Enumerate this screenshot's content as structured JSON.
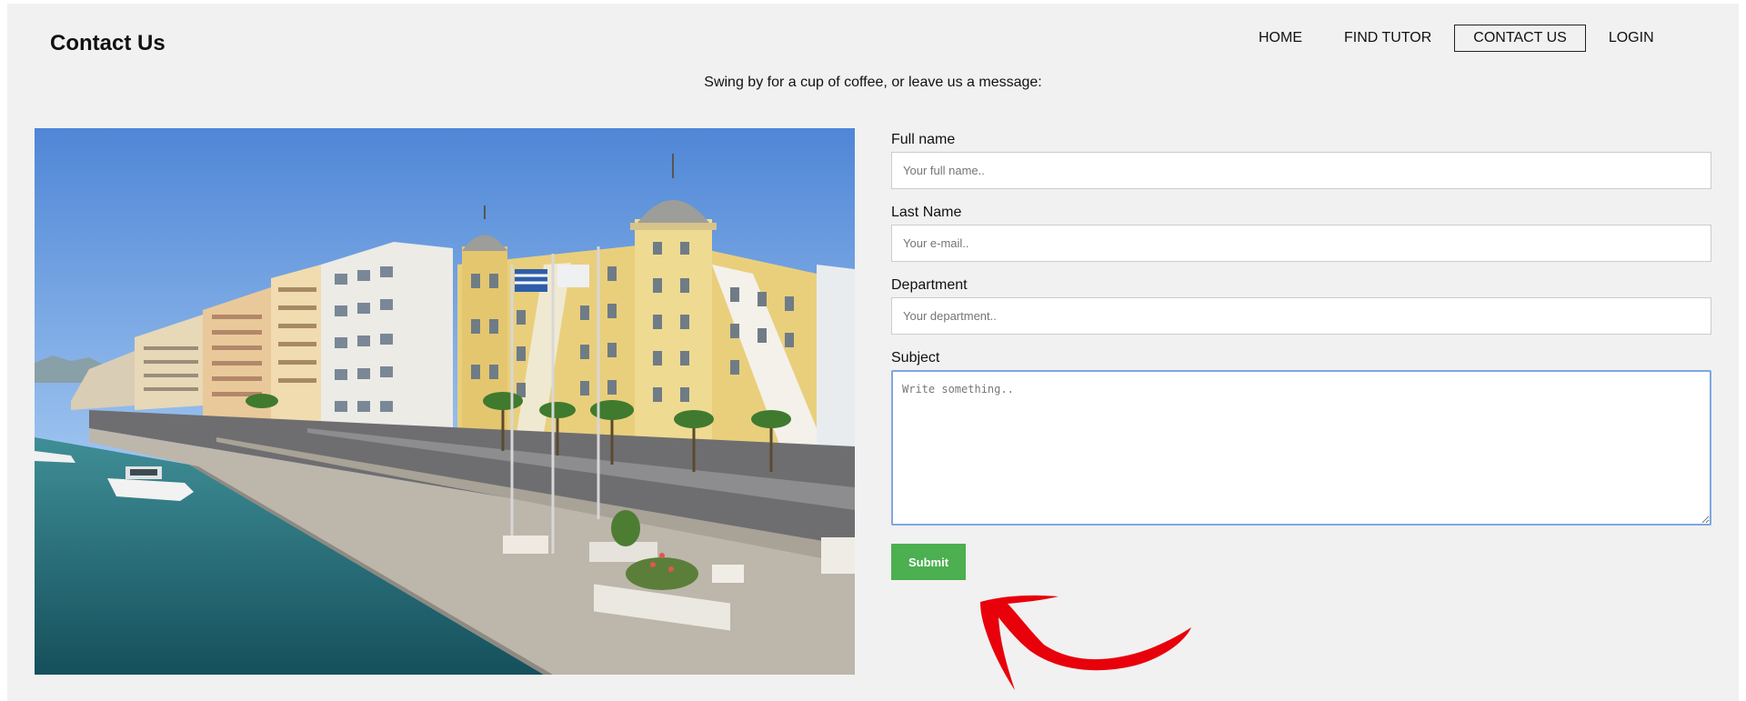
{
  "header": {
    "title": "Contact Us",
    "nav": [
      {
        "label": "HOME",
        "active": false
      },
      {
        "label": "FIND TUTOR",
        "active": false
      },
      {
        "label": "CONTACT US",
        "active": true
      },
      {
        "label": "LOGIN",
        "active": false
      }
    ]
  },
  "tagline": "Swing by for a cup of coffee, or leave us a message:",
  "photo": {
    "icon": "waterfront-building-photo"
  },
  "form": {
    "full_name": {
      "label": "Full name",
      "placeholder": "Your full name.."
    },
    "last_name": {
      "label": "Last Name",
      "placeholder": "Your e-mail.."
    },
    "department": {
      "label": "Department",
      "placeholder": "Your department.."
    },
    "subject": {
      "label": "Subject",
      "placeholder": "Write something.."
    },
    "submit_label": "Submit"
  },
  "colors": {
    "background": "#f1f1f1",
    "submit": "#4caf50",
    "focus_border": "#7ea6e0",
    "annotation_arrow": "#e8000b"
  },
  "annotation": {
    "icon": "red-arrow-icon"
  }
}
